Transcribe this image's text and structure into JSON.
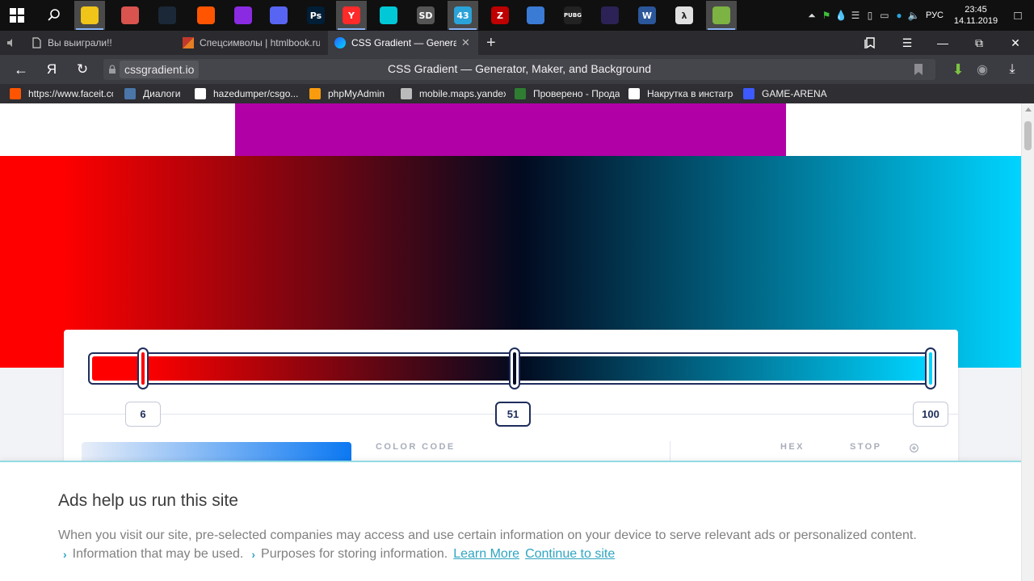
{
  "taskbar": {
    "apps": [
      {
        "name": "file-explorer",
        "label": "",
        "color": "#f0c419"
      },
      {
        "name": "shield-app",
        "label": "",
        "color": "#d9534f"
      },
      {
        "name": "steam",
        "label": "",
        "color": "#1b2838"
      },
      {
        "name": "faceit",
        "label": "",
        "color": "#ff5500"
      },
      {
        "name": "visual-studio",
        "label": "",
        "color": "#8a2be2"
      },
      {
        "name": "discord",
        "label": "",
        "color": "#5865f2"
      },
      {
        "name": "photoshop",
        "label": "Ps",
        "color": "#001e36"
      },
      {
        "name": "yandex-browser",
        "label": "Y",
        "color": "#ff2a2a"
      },
      {
        "name": "vpn-app",
        "label": "",
        "color": "#00c8d7"
      },
      {
        "name": "settings-sd",
        "label": "SD",
        "color": "#555555"
      },
      {
        "name": "telegram",
        "label": "43",
        "color": "#2aa3d8"
      },
      {
        "name": "filezilla",
        "label": "Z",
        "color": "#bf0000"
      },
      {
        "name": "paint-app",
        "label": "",
        "color": "#3a7bd5"
      },
      {
        "name": "pubg",
        "label": "PUBG",
        "color": "#222222"
      },
      {
        "name": "eclipse",
        "label": "",
        "color": "#2c2255"
      },
      {
        "name": "word-app",
        "label": "W",
        "color": "#2b579a"
      },
      {
        "name": "half-life",
        "label": "λ",
        "color": "#e0e0e0"
      },
      {
        "name": "notepad-app",
        "label": "",
        "color": "#7cb342"
      }
    ],
    "tray": {
      "language": "РУС",
      "time": "23:45",
      "date": "14.11.2019",
      "notification_count": "43"
    }
  },
  "tabs": [
    {
      "label": "Вы выиграли!!",
      "active": false
    },
    {
      "label": "Спецсимволы | htmlbook.ru",
      "active": false
    },
    {
      "label": "CSS Gradient — Generator",
      "active": true
    }
  ],
  "address": {
    "domain": "cssgradient.io",
    "title": "CSS Gradient — Generator, Maker, and Background"
  },
  "bookmarks": [
    {
      "label": "https://www.faceit.com",
      "color": "#ff5500"
    },
    {
      "label": "Диалоги",
      "color": "#4a76a8"
    },
    {
      "label": "hazedumper/csgo...",
      "color": "#ffffff"
    },
    {
      "label": "phpMyAdmin",
      "color": "#f89c0e"
    },
    {
      "label": "mobile.maps.yandex",
      "color": "#bbbbbb"
    },
    {
      "label": "Проверено - Продажи",
      "color": "#2e7d32"
    },
    {
      "label": "Накрутка в инстаграм",
      "color": "#ffffff"
    },
    {
      "label": "GAME-ARENA",
      "color": "#3d5afe"
    }
  ],
  "gradient": {
    "start_color": "#ff0000",
    "mid_color": "#020a1f",
    "end_color": "#00d4ff",
    "stops": [
      "6",
      "51",
      "100"
    ],
    "color_code_label": "COLOR CODE",
    "hex_label": "HEX",
    "stop_label": "STOP"
  },
  "colors": {
    "purple_block": "#b100a6",
    "accent": "#1f2d5c",
    "link": "#2fa5c2"
  },
  "consent": {
    "title": "Ads help us run this site",
    "text": "When you visit our site, pre-selected companies may access and use certain information on your device to serve relevant ads or personalized content.",
    "info_used": "Information that may be used.",
    "purposes": "Purposes for storing information.",
    "learn_more": "Learn More",
    "continue": "Continue to site"
  }
}
